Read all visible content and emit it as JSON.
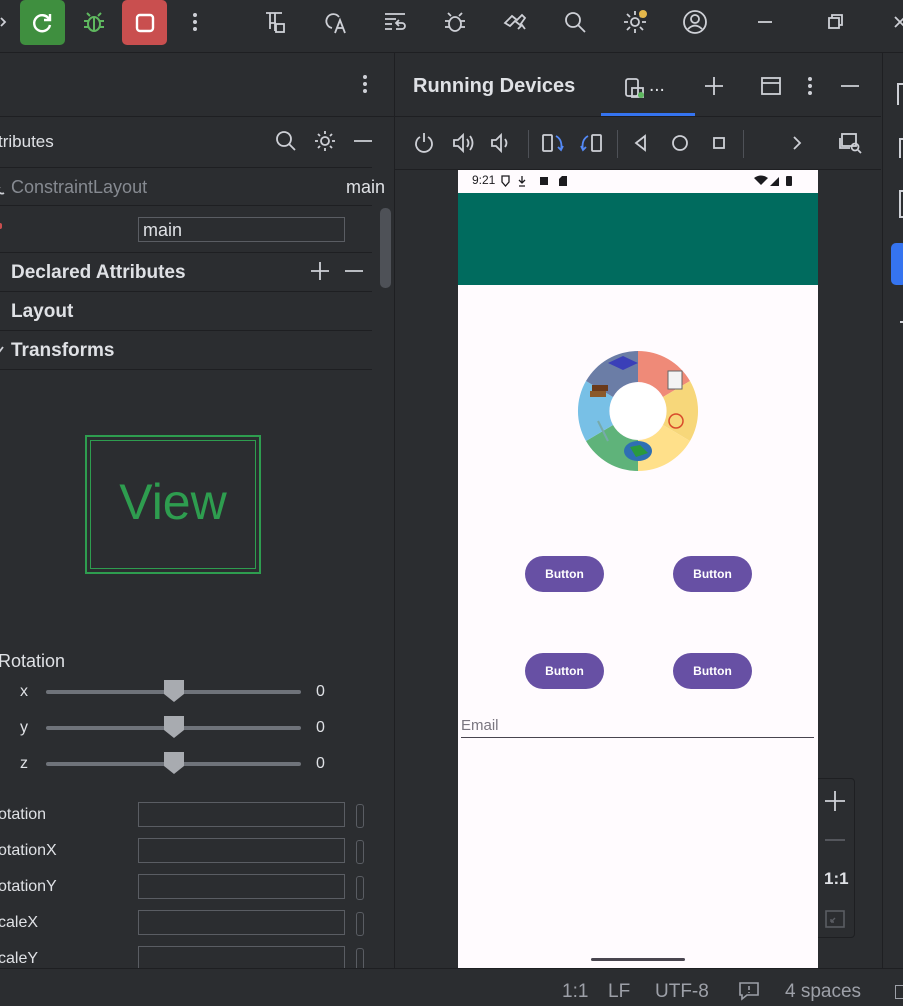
{
  "toolbar": {
    "icons": [
      "rerun-icon",
      "debug-icon",
      "stop-icon",
      "more-icon",
      "project-structure-icon",
      "translate-icon",
      "layout-inspector-icon",
      "device-manager-icon",
      "sync-icon",
      "search-icon",
      "settings-icon",
      "profile-icon",
      "minimize-icon",
      "restore-icon",
      "close-icon"
    ]
  },
  "attributes_panel": {
    "header_title": "tributes",
    "component_type": "ConstraintLayout",
    "component_id": "main",
    "id_field_value": "main",
    "sections": {
      "declared": "Declared Attributes",
      "layout": "Layout",
      "transforms": "Transforms"
    },
    "preview_label": "View",
    "rotation": {
      "label": "Rotation",
      "sliders": [
        {
          "axis": "x",
          "value": "0"
        },
        {
          "axis": "y",
          "value": "0"
        },
        {
          "axis": "z",
          "value": "0"
        }
      ]
    },
    "fields": [
      "otation",
      "otationX",
      "otationY",
      "caleX",
      "caleY"
    ]
  },
  "running_devices": {
    "title": "Running Devices",
    "tab_label": "...",
    "device": {
      "clock": "9:21",
      "appbar_text": "",
      "buttons": [
        "Button",
        "Button",
        "Button",
        "Button"
      ],
      "email_hint": "Email"
    },
    "zoom": {
      "fit_label": "1:1"
    }
  },
  "status_bar": {
    "position": "1:1",
    "line_sep": "LF",
    "encoding": "UTF-8",
    "indent": "4 spaces"
  },
  "colors": {
    "appbar": "#006b5e",
    "button": "#6750a4",
    "rerun": "#3f8f3f",
    "stop": "#c94f4f",
    "accent": "#3574f0",
    "preview_green": "#2e9d4f"
  }
}
